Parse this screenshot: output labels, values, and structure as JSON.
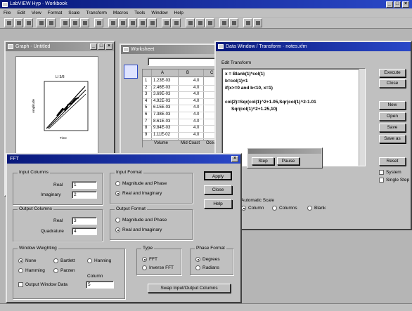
{
  "app": {
    "title": "LabVIEW Hyp · Workbook",
    "close_glyph": "×"
  },
  "menu": [
    "File",
    "Edit",
    "View",
    "Format",
    "Scale",
    "Transform",
    "Macros",
    "Tools",
    "Window",
    "Help"
  ],
  "graph_window": {
    "title": "Graph - Untitled",
    "plot_title": "LI 3/8",
    "ylabel": "Amplitude",
    "xlabel": "Time"
  },
  "worksheet_window": {
    "title": "Worksheet",
    "column_headers": [
      "A",
      "B",
      "C"
    ],
    "col_a": [
      "1.23E-03",
      "2.46E-03",
      "3.69E-03",
      "4.92E-03",
      "6.15E-03",
      "7.38E-03",
      "8.61E-03",
      "9.84E-03",
      "1.11E-02"
    ],
    "col_b": [
      "4.0",
      "4.0",
      "4.0",
      "4.0",
      "4.0",
      "4.0",
      "4.0",
      "4.0",
      "4.0"
    ],
    "footer": [
      "Volume",
      "Mid Coast",
      "Ocea"
    ]
  },
  "editor_window": {
    "title": "Data Window / Transform · notes.xfm",
    "label": "Edit Transform",
    "code": [
      "x = Blank(1)*col(1)",
      "b=col(1)+1",
      "if(x>=0 and b<10, x=1)",
      "",
      "col(2)=Sqr(col(1)^2+1.05,Sqr(col(1)^2-1.01",
      "     Sqr(col(1)^2+1.25,10)"
    ],
    "buttons": [
      "Execute",
      "Close",
      "New",
      "Open",
      "Save",
      "Save as",
      "Reset"
    ],
    "checks": [
      "System",
      "Single Step"
    ],
    "options_label": "Automatic Scale",
    "options": [
      "Column",
      "Columns",
      "Blank"
    ],
    "popup_buttons": [
      "Step",
      "Pause"
    ]
  },
  "fft_dialog": {
    "title": "FFT",
    "close_glyph": "×",
    "input_group": "Input Columns",
    "real_label": "Real",
    "real_value": "1",
    "imag_label": "Imaginary",
    "imag_value": "2",
    "output_group": "Output Columns",
    "out_real_label": "Real",
    "out_real_value": "3",
    "out_imag_label": "Quadrature",
    "out_imag_value": "4",
    "input_format_group": "Input Format",
    "input_format": [
      "Magnitude and Phase",
      "Real and Imaginary"
    ],
    "output_format_group": "Output Format",
    "output_format": [
      "Magnitude and Phase",
      "Real and Imaginary"
    ],
    "buttons": [
      "Apply",
      "Close",
      "Help"
    ],
    "window_group": "Window Weighting",
    "window_opts": [
      "None",
      "Bartlett",
      "Hanning",
      "Hamming",
      "Parzen"
    ],
    "window_option_check": "Output Window Data",
    "column_label": "Column",
    "column_value": "5",
    "type_group": "Type",
    "type_opts": [
      "FFT",
      "Inverse FFT"
    ],
    "phase_group": "Phase Format",
    "phase_opts": [
      "Degrees",
      "Radians"
    ],
    "swap_button": "Swap Input/Output Columns"
  }
}
